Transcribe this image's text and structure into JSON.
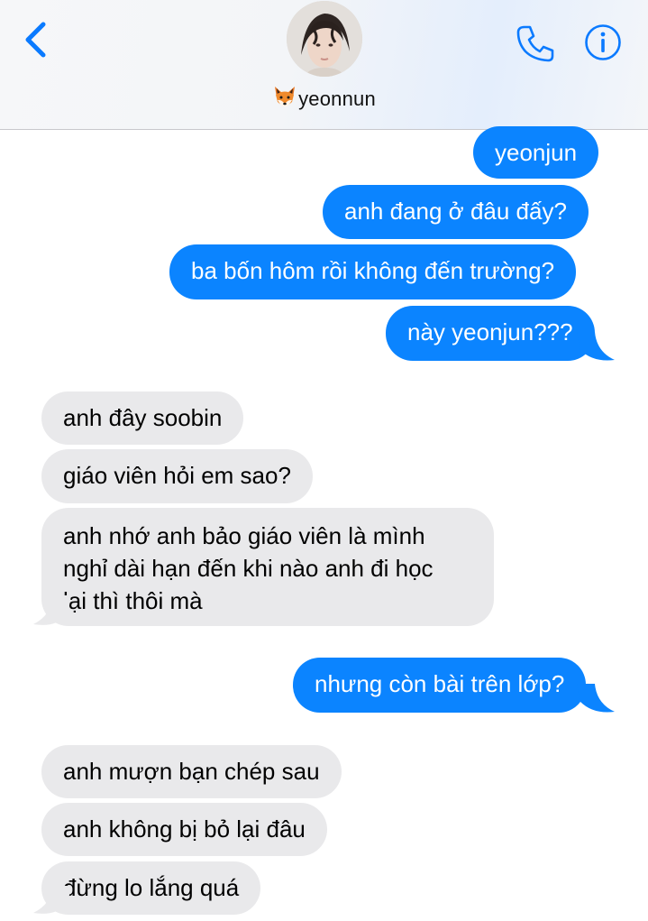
{
  "header": {
    "contact_name": "yeonnun",
    "icons": {
      "back": "chevron-left-icon",
      "call": "phone-icon",
      "info": "info-icon",
      "name_emoji": "fox-emoji"
    }
  },
  "colors": {
    "sent_bubble": "#0b84ff",
    "received_bubble": "#e9e9eb",
    "accent": "#0a7aff"
  },
  "messages": [
    {
      "from": "me",
      "text": "yeonjun"
    },
    {
      "from": "me",
      "text": "anh đang ở đâu đấy?"
    },
    {
      "from": "me",
      "text": "ba bốn hôm rồi không đến trường?"
    },
    {
      "from": "me",
      "text": "này yeonjun???"
    },
    {
      "from": "them",
      "text": "anh đây soobin"
    },
    {
      "from": "them",
      "text": "giáo viên hỏi em sao?"
    },
    {
      "from": "them",
      "lines": [
        "anh nhớ anh bảo giáo viên là mình",
        "nghỉ dài hạn đến khi nào anh đi học",
        "lại thì thôi mà"
      ]
    },
    {
      "from": "me",
      "text": "nhưng còn bài trên lớp?"
    },
    {
      "from": "them",
      "text": "anh mượn bạn chép sau"
    },
    {
      "from": "them",
      "text": "anh không bị bỏ lại đâu"
    },
    {
      "from": "them",
      "text": "đừng lo lắng quá"
    }
  ]
}
